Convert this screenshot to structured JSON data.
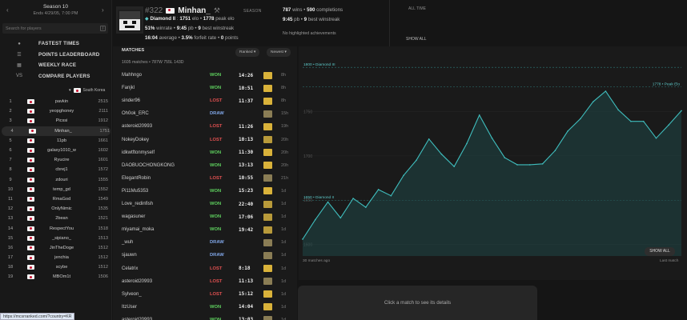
{
  "sidebar": {
    "season_title": "Season 10",
    "season_ends": "Ends 4/29/05, 7:00 PM",
    "search_placeholder": "Search for players",
    "search_shortcut": "/",
    "nav": [
      {
        "icon": "globe-icon",
        "label": "FASTEST TIMES"
      },
      {
        "icon": "trophy-icon",
        "label": "POINTS LEADERBOARD"
      },
      {
        "icon": "calendar-icon",
        "label": "WEEKLY RACE"
      },
      {
        "icon": "versus-icon",
        "label": "COMPARE PLAYERS"
      }
    ],
    "region_label": "South Korea",
    "leaderboard": [
      {
        "rank": "1",
        "name": "pavkin",
        "elo": "2515"
      },
      {
        "rank": "2",
        "name": "yeopghoney",
        "elo": "2111"
      },
      {
        "rank": "3",
        "name": "Picssi",
        "elo": "1912"
      },
      {
        "rank": "4",
        "name": "Minhan_",
        "elo": "1751"
      },
      {
        "rank": "5",
        "name": "11pb",
        "elo": "1661"
      },
      {
        "rank": "6",
        "name": "galaxy1010_w",
        "elo": "1602"
      },
      {
        "rank": "7",
        "name": "Ryucire",
        "elo": "1601"
      },
      {
        "rank": "8",
        "name": "cbrej1",
        "elo": "1572"
      },
      {
        "rank": "9",
        "name": "zdouri",
        "elo": "1555"
      },
      {
        "rank": "10",
        "name": "temp_gd",
        "elo": "1552"
      },
      {
        "rank": "11",
        "name": "RmaGod",
        "elo": "1549"
      },
      {
        "rank": "12",
        "name": "OnlyNimic",
        "elo": "1535"
      },
      {
        "rank": "13",
        "name": "2bean",
        "elo": "1521"
      },
      {
        "rank": "14",
        "name": "RespectYou",
        "elo": "1518"
      },
      {
        "rank": "15",
        "name": "_sipiano_",
        "elo": "1513"
      },
      {
        "rank": "16",
        "name": "JinTheDoge",
        "elo": "1512"
      },
      {
        "rank": "17",
        "name": "jenchia",
        "elo": "1512"
      },
      {
        "rank": "18",
        "name": "scybe",
        "elo": "1512"
      },
      {
        "rank": "19",
        "name": "MBOm1t",
        "elo": "1506"
      }
    ],
    "status_url": "https://mcsrranked.com/?country=KR"
  },
  "player": {
    "rank": "#322",
    "name": "Minhan_",
    "season_tag": "SEASON",
    "tier": "Diamond II",
    "elo": "1751",
    "elo_suffix": "elo",
    "peak": "1778",
    "peak_suffix": "peak elo",
    "winrate": "51%",
    "winrate_suffix": "winrate",
    "pb": "9:45",
    "pb_suffix": "pb",
    "best_winstreak": "9",
    "best_winstreak_suffix": "best winstreak",
    "average": "16:04",
    "average_suffix": "average",
    "forfeit_rate": "3.5%",
    "forfeit_suffix": "forfeit rate",
    "points": "0",
    "points_suffix": "points",
    "alltime_tag": "ALL TIME",
    "wins": "787",
    "wins_suffix": "wins",
    "completions": "590",
    "completions_suffix": "completions",
    "alltime_pb": "9:45",
    "alltime_pb_suffix": "pb",
    "alltime_winstreak": "9",
    "alltime_winstreak_suffix": "best winstreak",
    "achievements": "No highlighted achievements",
    "show_all": "SHOW ALL"
  },
  "matches": {
    "title": "MATCHES",
    "summary": "1605 matches • 787W 755L 143D",
    "filter_ranked": "Ranked",
    "filter_newest": "Newest",
    "rows": [
      {
        "opponent": "Mahhngo",
        "result": "WON",
        "time": "14:26",
        "ago": "8h",
        "seed": "village"
      },
      {
        "opponent": "Fanjkl",
        "result": "WON",
        "time": "10:51",
        "ago": "8h",
        "seed": "village"
      },
      {
        "opponent": "sinder96",
        "result": "LOST",
        "time": "11:37",
        "ago": "8h",
        "seed": "village"
      },
      {
        "opponent": "Oh0ok_ERC",
        "result": "DRAW",
        "time": "",
        "ago": "15h",
        "seed": "shipwreck"
      },
      {
        "opponent": "asteroid20993",
        "result": "LOST",
        "time": "11:26",
        "ago": "19h",
        "seed": "village"
      },
      {
        "opponent": "NokeyDokey",
        "result": "LOST",
        "time": "10:13",
        "ago": "20h",
        "seed": "temple"
      },
      {
        "opponent": "idkwtftonmyself",
        "result": "WON",
        "time": "11:30",
        "ago": "20h",
        "seed": "village"
      },
      {
        "opponent": "DAOBUOCHONGKONG",
        "result": "WON",
        "time": "13:13",
        "ago": "20h",
        "seed": "village"
      },
      {
        "opponent": "ElegantRobin",
        "result": "LOST",
        "time": "10:55",
        "ago": "21h",
        "seed": "shipwreck"
      },
      {
        "opponent": "Pi11Mu5353",
        "result": "WON",
        "time": "15:23",
        "ago": "1d",
        "seed": "village"
      },
      {
        "opponent": "Love_redinfish",
        "result": "WON",
        "time": "22:40",
        "ago": "1d",
        "seed": "temple"
      },
      {
        "opponent": "wagasuner",
        "result": "WON",
        "time": "17:06",
        "ago": "1d",
        "seed": "temple"
      },
      {
        "opponent": "miyamai_moka",
        "result": "WON",
        "time": "19:42",
        "ago": "1d",
        "seed": "temple"
      },
      {
        "opponent": "_wuh",
        "result": "DRAW",
        "time": "",
        "ago": "1d",
        "seed": "shipwreck"
      },
      {
        "opponent": "sjauwn",
        "result": "DRAW",
        "time": "",
        "ago": "1d",
        "seed": "shipwreck"
      },
      {
        "opponent": "Celatrix",
        "result": "LOST",
        "time": "8:18",
        "ago": "1d",
        "seed": "village"
      },
      {
        "opponent": "asteroid20993",
        "result": "LOST",
        "time": "11:13",
        "ago": "1d",
        "seed": "shipwreck"
      },
      {
        "opponent": "Sylveon_",
        "result": "LOST",
        "time": "15:12",
        "ago": "1d",
        "seed": "village"
      },
      {
        "opponent": "ItzUser",
        "result": "WON",
        "time": "14:04",
        "ago": "1d",
        "seed": "village"
      },
      {
        "opponent": "asteroid20993",
        "result": "WON",
        "time": "13:03",
        "ago": "1d",
        "seed": "shipwreck"
      }
    ]
  },
  "colors": {
    "won": "#5ed05e",
    "lost": "#e05050",
    "draw": "#7fa5e6",
    "accent": "#5cc8c8",
    "village": "#d9b23a",
    "temple": "#b89a3a",
    "shipwreck": "#8a7d55"
  },
  "chart_data": {
    "type": "area",
    "xlabel_left": "30 matches ago",
    "xlabel_right": "Last match",
    "show_all": "SHOW ALL",
    "y_ticks": [
      "1750",
      "1700",
      "1650",
      "1600"
    ],
    "ylim": [
      1587,
      1820
    ],
    "reference_lines": [
      {
        "value": 1800,
        "label": "1800 • Diamond III"
      },
      {
        "value": 1778,
        "label": "1778 • Peak Elo"
      },
      {
        "value": 1650,
        "label": "1650 • Diamond II"
      }
    ],
    "values": [
      1606,
      1628,
      1648,
      1630,
      1652,
      1642,
      1662,
      1655,
      1678,
      1695,
      1719,
      1702,
      1688,
      1714,
      1746,
      1720,
      1698,
      1690,
      1690,
      1691,
      1706,
      1728,
      1742,
      1761,
      1773,
      1752,
      1739,
      1739,
      1720,
      1735,
      1751
    ]
  },
  "detail_hint": "Click a match to see its details"
}
